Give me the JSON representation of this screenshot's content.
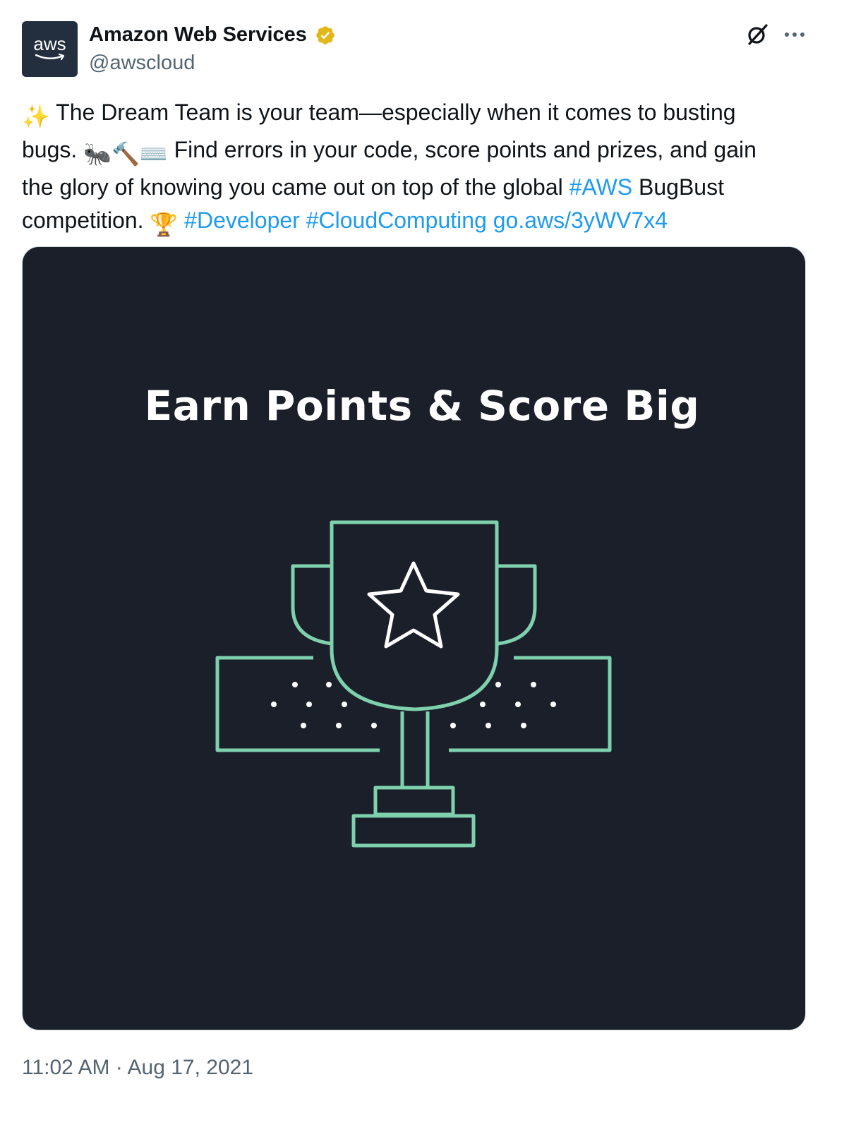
{
  "author": {
    "display_name": "Amazon Web Services",
    "handle": "@awscloud",
    "avatar_text": "aws",
    "verified": true,
    "verified_badge_color": "#e2b719"
  },
  "tweet": {
    "line1_emoji": "✨",
    "line1_text": " The Dream Team is your team—especially when it comes to busting",
    "line2_text_a": "bugs. ",
    "line2_emojis": "🐜🔨⌨️",
    "line2_text_b": " Find errors in your code, score points and prizes, and gain",
    "line3_text_a": "the glory of knowing you came out on top of the global ",
    "line3_link_aws": "#AWS",
    "line3_text_b": " BugBust",
    "line4_text_a": "competition. ",
    "line4_emoji": "🏆",
    "line4_space": " ",
    "hashtag_developer": "#Developer",
    "hashtag_cloud": "#CloudComputing",
    "short_link": "go.aws/3yWV7x4",
    "link_color": "#1d9bf0"
  },
  "media": {
    "title": "Earn Points & Score Big",
    "background_color": "#1a1f2a",
    "accent_color": "#7fd1ae",
    "icons": [
      "trophy-icon",
      "star-icon"
    ]
  },
  "timestamp": "11:02 AM · Aug 17, 2021",
  "header_icons": [
    "grok-icon",
    "more-icon"
  ]
}
